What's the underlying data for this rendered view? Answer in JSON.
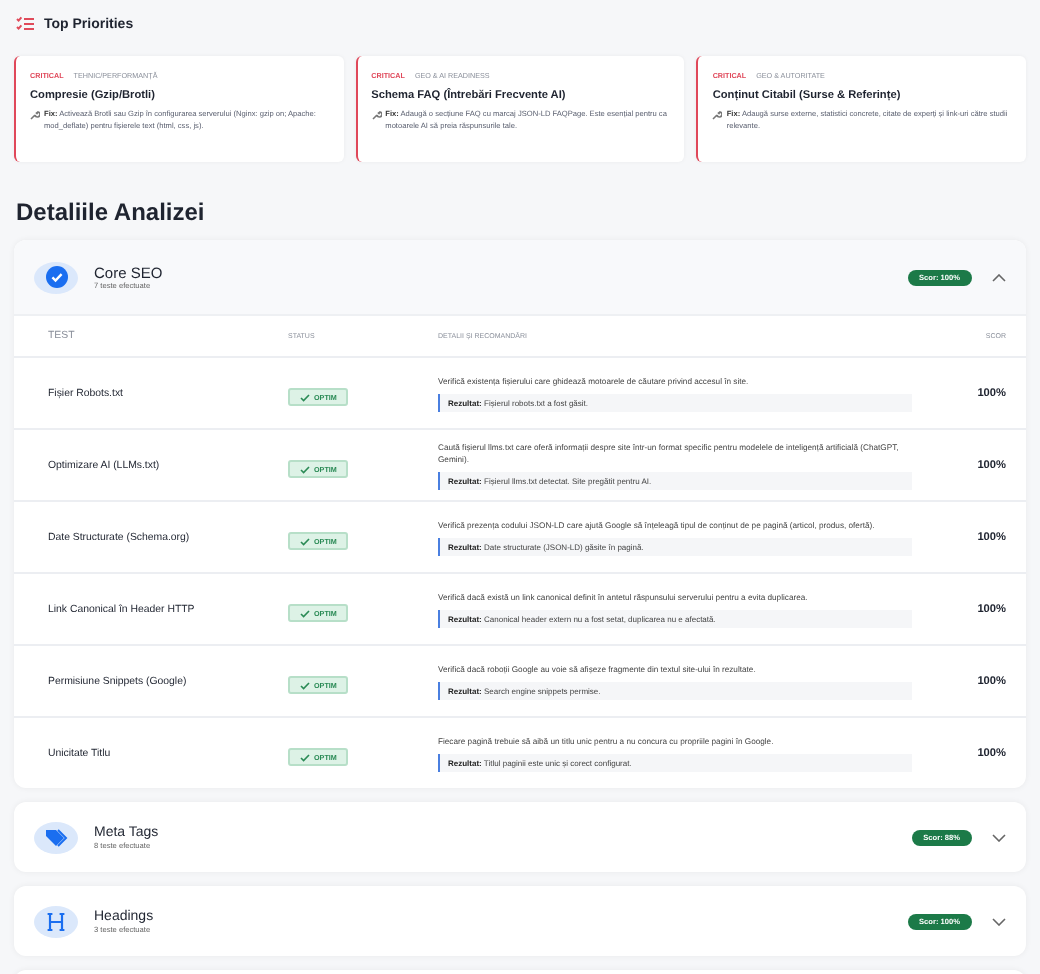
{
  "priorities": {
    "title": "Top Priorities",
    "items": [
      {
        "severity": "CRITICAL",
        "category": "TEHNIC/PERFORMANȚĂ",
        "title": "Compresie (Gzip/Brotli)",
        "fix": "**Fix:** Activează Brotli sau Gzip în configurarea serverului (Nginx: gzip on; Apache: mod_deflate) pentru fișierele text (html, css, js)."
      },
      {
        "severity": "CRITICAL",
        "category": "GEO & AI READINESS",
        "title": "Schema FAQ (Întrebări Frecvente AI)",
        "fix": "**Fix:** Adaugă o secțiune FAQ cu marcaj JSON-LD FAQPage. Este esențial pentru ca motoarele AI să preia răspunsurile tale."
      },
      {
        "severity": "CRITICAL",
        "category": "GEO & AUTORITATE",
        "title": "Conținut Citabil (Surse & Referințe)",
        "fix": "**Fix:** Adaugă surse externe, statistici concrete, citate de experți și link-uri către studii relevante."
      }
    ]
  },
  "details_title": "Detaliile Analizei",
  "sections": [
    {
      "title": "Core SEO",
      "subtitle": "7 teste efectuate",
      "score": "Scor: 100%",
      "expanded": true,
      "columns": [
        "TEST",
        "STATUS",
        "DETALII ȘI RECOMANDĂRI",
        "SCOR"
      ],
      "rows": [
        {
          "test": "Fișier Robots.txt",
          "status": "OPTIM",
          "description": "Verifică existența fișierului care ghidează motoarele de căutare privind accesul în site.",
          "result": "**Rezultat:** Fișierul robots.txt a fost găsit.",
          "score": "100%"
        },
        {
          "test": "Optimizare AI (LLMs.txt)",
          "status": "OPTIM",
          "description": "Caută fișierul llms.txt care oferă informații despre site într-un format specific pentru modelele de inteligență artificială (ChatGPT, Gemini).",
          "result": "**Rezultat:** Fișierul llms.txt detectat. Site pregătit pentru AI.",
          "score": "100%"
        },
        {
          "test": "Date Structurate (Schema.org)",
          "status": "OPTIM",
          "description": "Verifică prezența codului JSON-LD care ajută Google să înțeleagă tipul de conținut de pe pagină (articol, produs, ofertă).",
          "result": "**Rezultat:** Date structurate (JSON-LD) găsite în pagină.",
          "score": "100%"
        },
        {
          "test": "Link Canonical în Header HTTP",
          "status": "OPTIM",
          "description": "Verifică dacă există un link canonical definit în antetul răspunsului serverului pentru a evita duplicarea.",
          "result": "**Rezultat:** Canonical header extern nu a fost setat, duplicarea nu e afectată.",
          "score": "100%"
        },
        {
          "test": "Permisiune Snippets (Google)",
          "status": "OPTIM",
          "description": "Verifică dacă roboții Google au voie să afișeze fragmente din textul site-ului în rezultate.",
          "result": "**Rezultat:** Search engine snippets permise.",
          "score": "100%"
        },
        {
          "test": "Unicitate Titlu",
          "status": "OPTIM",
          "description": "Fiecare pagină trebuie să aibă un titlu unic pentru a nu concura cu propriile pagini în Google.",
          "result": "**Rezultat:** Titlul paginii este unic și corect configurat.",
          "score": "100%"
        }
      ]
    },
    {
      "title": "Meta Tags",
      "subtitle": "8 teste efectuate",
      "score": "Scor: 88%",
      "expanded": false
    },
    {
      "title": "Headings",
      "subtitle": "3 teste efectuate",
      "score": "Scor: 100%",
      "expanded": false
    }
  ]
}
